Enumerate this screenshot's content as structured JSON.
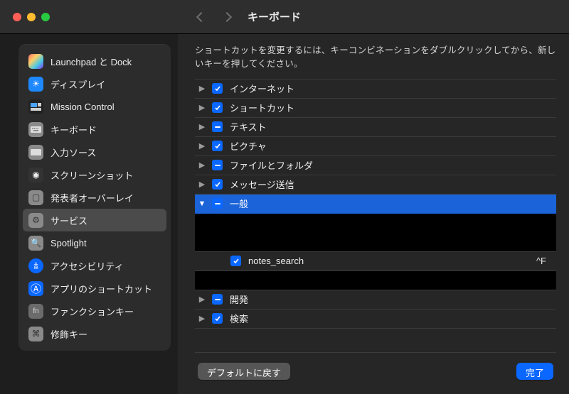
{
  "window": {
    "title": "キーボード"
  },
  "sidebar": {
    "items": [
      {
        "label": "Launchpad と Dock"
      },
      {
        "label": "ディスプレイ"
      },
      {
        "label": "Mission Control"
      },
      {
        "label": "キーボード"
      },
      {
        "label": "入力ソース"
      },
      {
        "label": "スクリーンショット"
      },
      {
        "label": "発表者オーバーレイ"
      },
      {
        "label": "サービス"
      },
      {
        "label": "Spotlight"
      },
      {
        "label": "アクセシビリティ"
      },
      {
        "label": "アプリのショートカット"
      },
      {
        "label": "ファンクションキー"
      },
      {
        "label": "修飾キー"
      }
    ]
  },
  "hint": "ショートカットを変更するには、キーコンビネーションをダブルクリックしてから、新しいキーを押してください。",
  "groups": [
    {
      "label": "インターネット",
      "state": "on",
      "open": false
    },
    {
      "label": "ショートカット",
      "state": "on",
      "open": false
    },
    {
      "label": "テキスト",
      "state": "mix",
      "open": false
    },
    {
      "label": "ピクチャ",
      "state": "on",
      "open": false
    },
    {
      "label": "ファイルとフォルダ",
      "state": "mix",
      "open": false
    },
    {
      "label": "メッセージ送信",
      "state": "on",
      "open": false
    },
    {
      "label": "一般",
      "state": "mix",
      "open": true
    },
    {
      "label": "開発",
      "state": "mix",
      "open": false
    },
    {
      "label": "検索",
      "state": "on",
      "open": false
    }
  ],
  "general_children": [
    {
      "kind": "hidden"
    },
    {
      "kind": "hidden"
    },
    {
      "kind": "item",
      "label": "notes_search",
      "shortcut": "^F",
      "state": "on"
    },
    {
      "kind": "hidden"
    }
  ],
  "footer": {
    "reset": "デフォルトに戻す",
    "done": "完了"
  },
  "colors": {
    "accent": "#0a67ff",
    "selection": "#1b63d8"
  }
}
